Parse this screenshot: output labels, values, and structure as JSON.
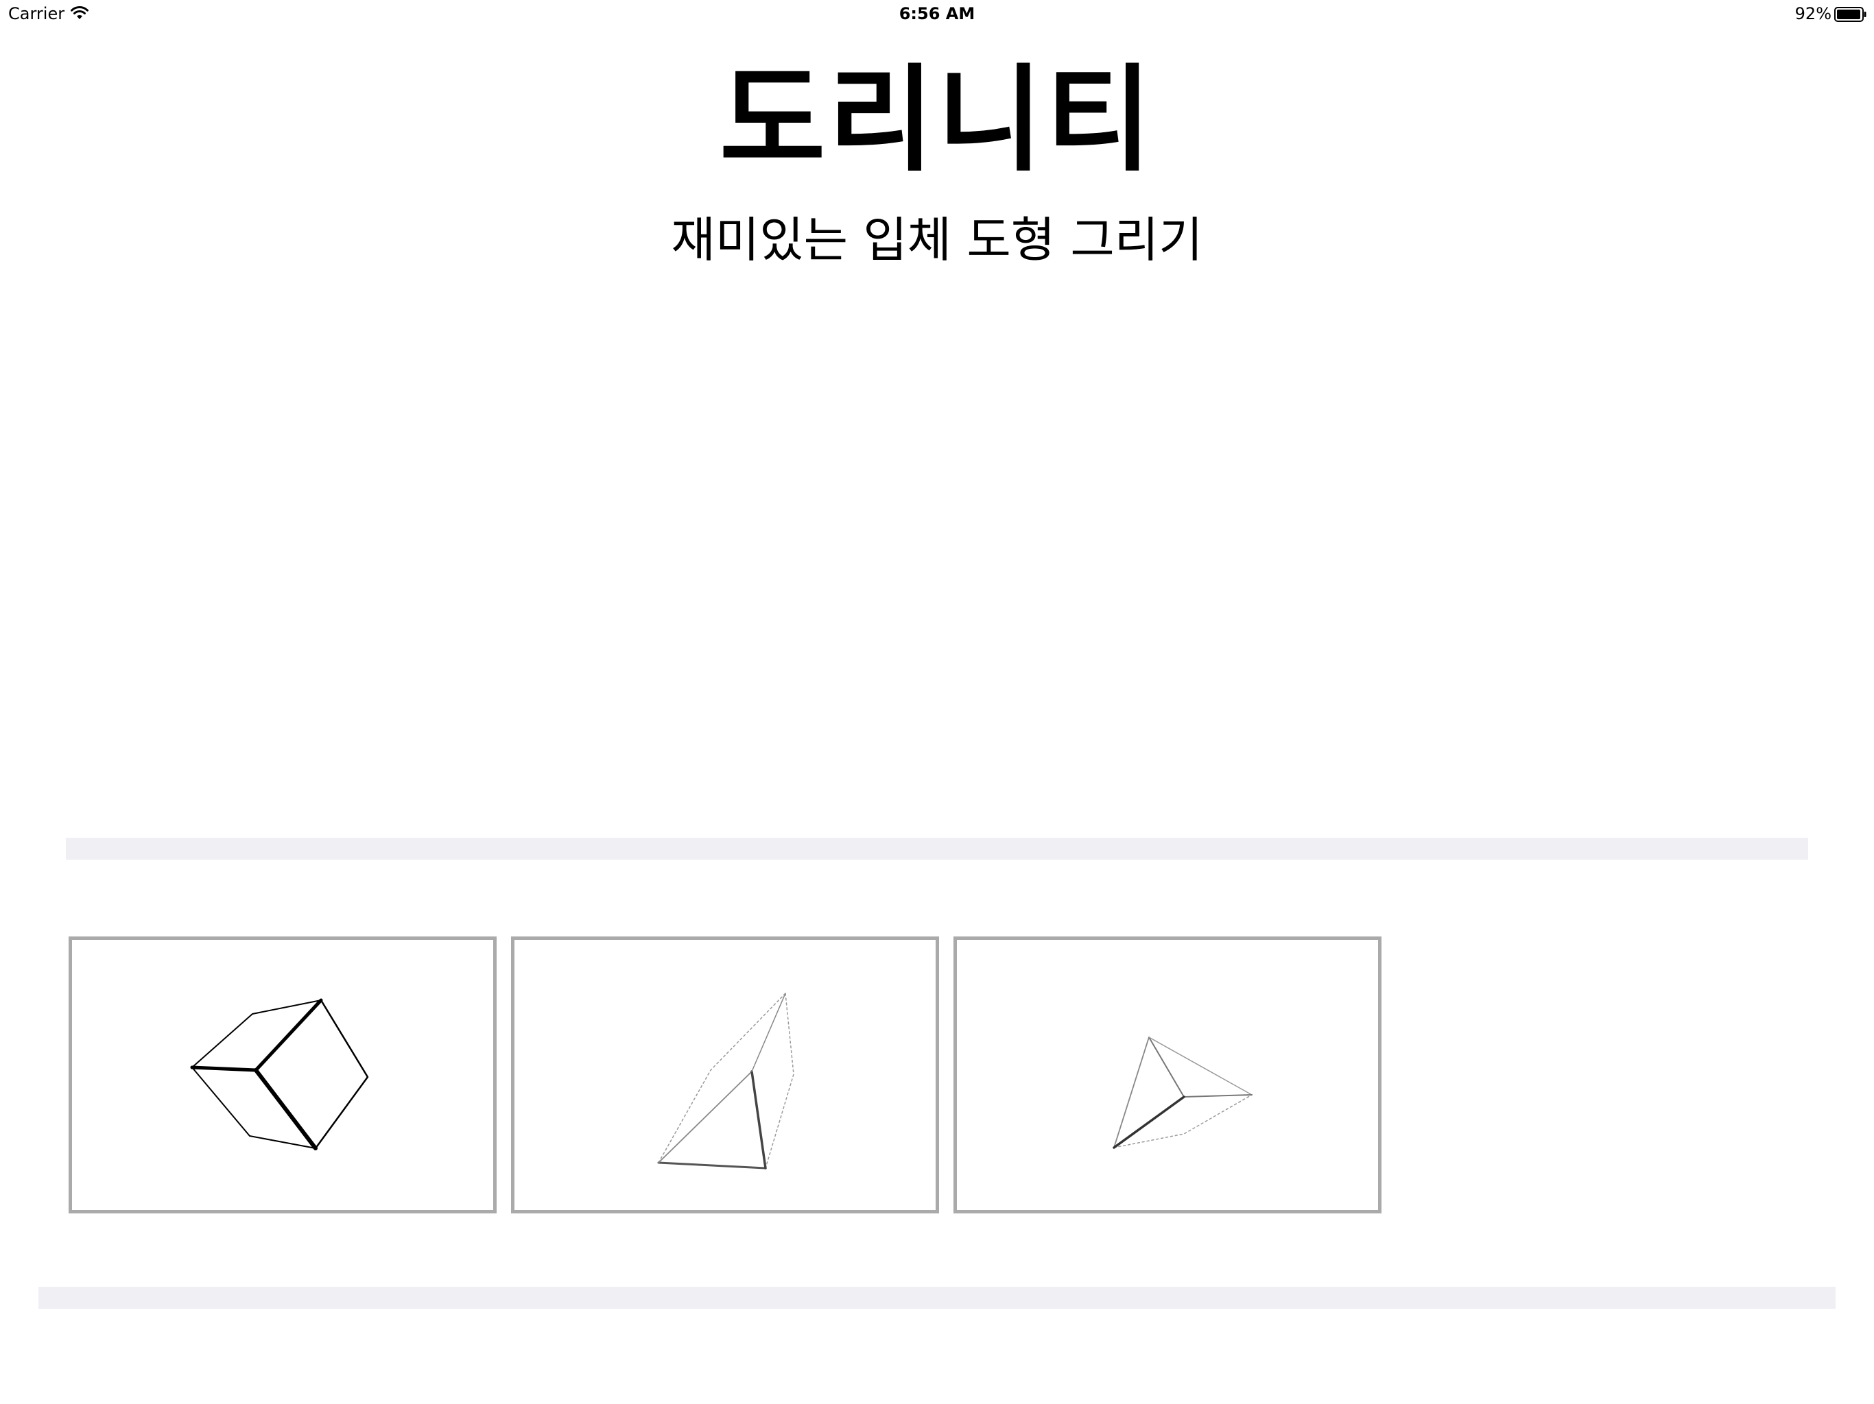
{
  "status_bar": {
    "carrier": "Carrier",
    "time": "6:56 AM",
    "battery": "92%",
    "wifi_icon": "wifi-icon",
    "battery_icon": "battery-icon"
  },
  "header": {
    "title": "도리니티",
    "subtitle": "재미있는 입체 도형 그리기"
  },
  "shapes": [
    {
      "name": "cube",
      "icon": "cube-icon"
    },
    {
      "name": "triangular-pyramid",
      "icon": "pyramid-icon"
    },
    {
      "name": "tetrahedron",
      "icon": "tetrahedron-icon"
    }
  ],
  "colors": {
    "background": "#ffffff",
    "divider": "#efeff4",
    "card_border": "#aaaaaa",
    "text": "#000000"
  }
}
